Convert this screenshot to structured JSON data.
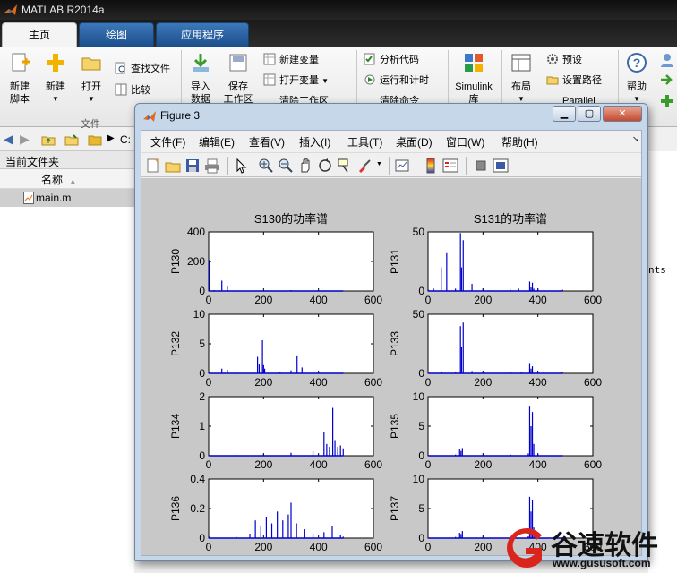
{
  "app": {
    "title": "MATLAB R2014a"
  },
  "tabs": [
    {
      "label": "主页",
      "active": true
    },
    {
      "label": "绘图",
      "active": false
    },
    {
      "label": "应用程序",
      "active": false
    }
  ],
  "ribbon": {
    "new_script": "新建\n脚本",
    "new": "新建",
    "open": "打开",
    "find_files": "查找文件",
    "compare": "比较",
    "file_group": "文件",
    "import": "导入\n数据",
    "save": "保存\n工作区",
    "new_variable": "新建变量",
    "open_variable": "打开变量",
    "clear_workspace": "清除工作区",
    "analyze_code": "分析代码",
    "run_and_time": "运行和计时",
    "clear_commands": "清除命令",
    "simulink": "Simulink\n库",
    "layout": "布局",
    "preferences": "预设",
    "set_path": "设置路径",
    "parallel": "Parallel",
    "help": "帮助"
  },
  "address": {
    "path": "C:"
  },
  "current_folder": {
    "title": "当前文件夹",
    "column_name": "名称",
    "sort_indicator": "▲",
    "files": [
      {
        "name": "main.m"
      }
    ]
  },
  "command_fragment": "nts",
  "figure": {
    "title": "Figure 3",
    "menu": [
      "文件(F)",
      "编辑(E)",
      "查看(V)",
      "插入(I)",
      "工具(T)",
      "桌面(D)",
      "窗口(W)",
      "帮助(H)"
    ],
    "tools": [
      "new-figure-icon",
      "open-file-icon",
      "save-icon",
      "print-icon",
      "pointer-icon",
      "zoom-in-icon",
      "zoom-out-icon",
      "pan-hand-icon",
      "rotate-3d-icon",
      "data-cursor-icon",
      "brush-icon",
      "link-plot-icon",
      "colorbar-icon",
      "legend-icon",
      "hide-plot-tools-icon",
      "show-plot-tools-icon"
    ]
  },
  "chart_data": [
    {
      "type": "line",
      "title": "S130的功率谱",
      "xlabel": "",
      "ylabel": "P130",
      "xlim": [
        0,
        600
      ],
      "ylim": [
        0,
        400
      ],
      "xticks": [
        0,
        200,
        400,
        600
      ],
      "yticks": [
        0,
        200,
        400
      ],
      "color": "#0000cc",
      "series": [
        {
          "x": [
            2,
            20,
            40,
            48,
            60,
            68,
            80,
            100,
            150,
            200,
            260,
            300,
            350,
            400,
            450,
            490
          ],
          "values": [
            210,
            6,
            4,
            70,
            3,
            30,
            3,
            4,
            2,
            5,
            2,
            6,
            2,
            3,
            2,
            2
          ]
        }
      ]
    },
    {
      "type": "line",
      "title": "S131的功率谱",
      "xlabel": "",
      "ylabel": "P131",
      "xlim": [
        0,
        600
      ],
      "ylim": [
        0,
        50
      ],
      "xticks": [
        0,
        200,
        400,
        600
      ],
      "yticks": [
        0,
        50
      ],
      "color": "#0000cc",
      "series": [
        {
          "x": [
            2,
            20,
            48,
            68,
            100,
            118,
            122,
            128,
            160,
            200,
            300,
            330,
            370,
            375,
            380,
            385,
            400,
            490
          ],
          "values": [
            1,
            2,
            20,
            32,
            2,
            49,
            20,
            43,
            6,
            2,
            1,
            2,
            8,
            3,
            7,
            2,
            2,
            1
          ]
        }
      ]
    },
    {
      "type": "line",
      "title": "",
      "xlabel": "",
      "ylabel": "P132",
      "xlim": [
        0,
        600
      ],
      "ylim": [
        0,
        10
      ],
      "xticks": [
        0,
        200,
        400,
        600
      ],
      "yticks": [
        0,
        5,
        10
      ],
      "color": "#0000cc",
      "series": [
        {
          "x": [
            2,
            48,
            68,
            100,
            178,
            184,
            196,
            200,
            204,
            260,
            300,
            322,
            340,
            400,
            490
          ],
          "values": [
            0.2,
            0.8,
            0.6,
            0.2,
            2.8,
            1.5,
            5.6,
            1.4,
            0.8,
            0.3,
            0.5,
            2.9,
            1.0,
            0.2,
            0.1
          ]
        }
      ]
    },
    {
      "type": "line",
      "title": "",
      "xlabel": "",
      "ylabel": "P133",
      "xlim": [
        0,
        600
      ],
      "ylim": [
        0,
        50
      ],
      "xticks": [
        0,
        200,
        400,
        600
      ],
      "yticks": [
        0,
        50
      ],
      "color": "#0000cc",
      "series": [
        {
          "x": [
            2,
            50,
            100,
            118,
            122,
            128,
            160,
            200,
            300,
            340,
            370,
            375,
            380,
            400,
            490
          ],
          "values": [
            0.5,
            1,
            1,
            40,
            22,
            43,
            2,
            1,
            1,
            1,
            8,
            4,
            6,
            1,
            1
          ]
        }
      ]
    },
    {
      "type": "line",
      "title": "",
      "xlabel": "",
      "ylabel": "P134",
      "xlim": [
        0,
        600
      ],
      "ylim": [
        0,
        2
      ],
      "xticks": [
        0,
        200,
        400,
        600
      ],
      "yticks": [
        0,
        1,
        2
      ],
      "color": "#0000cc",
      "series": [
        {
          "x": [
            2,
            100,
            200,
            300,
            380,
            420,
            430,
            440,
            452,
            460,
            470,
            480,
            490
          ],
          "values": [
            0.02,
            0.03,
            0.05,
            0.1,
            0.15,
            0.8,
            0.4,
            0.3,
            1.62,
            0.5,
            0.3,
            0.35,
            0.25
          ]
        }
      ]
    },
    {
      "type": "line",
      "title": "",
      "xlabel": "",
      "ylabel": "P135",
      "xlim": [
        0,
        600
      ],
      "ylim": [
        0,
        10
      ],
      "xticks": [
        0,
        200,
        400,
        600
      ],
      "yticks": [
        0,
        5,
        10
      ],
      "color": "#0000cc",
      "series": [
        {
          "x": [
            2,
            100,
            115,
            120,
            125,
            200,
            300,
            365,
            370,
            375,
            380,
            385,
            400,
            490
          ],
          "values": [
            0.1,
            0.2,
            1.1,
            0.8,
            1.3,
            0.2,
            0.2,
            0.4,
            8.3,
            5.0,
            7.4,
            2.0,
            0.3,
            0.1
          ]
        }
      ]
    },
    {
      "type": "line",
      "title": "",
      "xlabel": "",
      "ylabel": "P136",
      "xlim": [
        0,
        600
      ],
      "ylim": [
        0,
        0.4
      ],
      "xticks": [
        0,
        200,
        400,
        600
      ],
      "yticks": [
        0,
        0.2,
        0.4
      ],
      "color": "#0000cc",
      "series": [
        {
          "x": [
            2,
            100,
            150,
            170,
            190,
            210,
            230,
            250,
            270,
            290,
            300,
            320,
            350,
            380,
            420,
            450,
            480,
            490
          ],
          "values": [
            0.01,
            0.01,
            0.03,
            0.12,
            0.08,
            0.14,
            0.1,
            0.18,
            0.12,
            0.16,
            0.24,
            0.1,
            0.06,
            0.03,
            0.04,
            0.08,
            0.02,
            0.01
          ]
        }
      ]
    },
    {
      "type": "line",
      "title": "",
      "xlabel": "",
      "ylabel": "P137",
      "xlim": [
        0,
        600
      ],
      "ylim": [
        0,
        10
      ],
      "xticks": [
        0,
        200,
        400,
        600
      ],
      "yticks": [
        0,
        5,
        10
      ],
      "color": "#0000cc",
      "series": [
        {
          "x": [
            2,
            100,
            115,
            120,
            125,
            200,
            300,
            365,
            370,
            375,
            380,
            385,
            400,
            490
          ],
          "values": [
            0.1,
            0.2,
            0.9,
            0.7,
            1.2,
            0.2,
            0.2,
            0.3,
            7.0,
            4.5,
            6.5,
            1.8,
            0.3,
            0.1
          ]
        }
      ]
    }
  ],
  "watermark": {
    "brand": "谷速软件",
    "url": "www.gususoft.com",
    "accent": "#d9251c"
  }
}
